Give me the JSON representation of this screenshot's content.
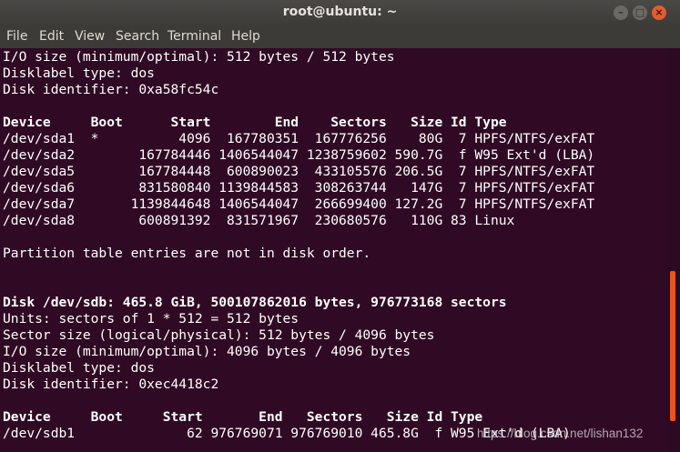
{
  "window": {
    "title": "root@ubuntu: ~",
    "min_symbol": "–",
    "max_symbol": "□",
    "close_symbol": "×"
  },
  "menu": [
    "File",
    "Edit",
    "View",
    "Search",
    "Terminal",
    "Help"
  ],
  "terminal_lines": [
    {
      "text": "I/O size (minimum/optimal): 512 bytes / 512 bytes",
      "bold": false
    },
    {
      "text": "Disklabel type: dos",
      "bold": false
    },
    {
      "text": "Disk identifier: 0xa58fc54c",
      "bold": false
    },
    {
      "text": "",
      "bold": false
    },
    {
      "text": "Device     Boot      Start        End    Sectors   Size Id Type",
      "bold": true
    },
    {
      "text": "/dev/sda1  *          4096  167780351  167776256    80G  7 HPFS/NTFS/exFAT",
      "bold": false
    },
    {
      "text": "/dev/sda2        167784446 1406544047 1238759602 590.7G  f W95 Ext'd (LBA)",
      "bold": false
    },
    {
      "text": "/dev/sda5        167784448  600890023  433105576 206.5G  7 HPFS/NTFS/exFAT",
      "bold": false
    },
    {
      "text": "/dev/sda6        831580840 1139844583  308263744   147G  7 HPFS/NTFS/exFAT",
      "bold": false
    },
    {
      "text": "/dev/sda7       1139844648 1406544047  266699400 127.2G  7 HPFS/NTFS/exFAT",
      "bold": false
    },
    {
      "text": "/dev/sda8        600891392  831571967  230680576   110G 83 Linux",
      "bold": false
    },
    {
      "text": "",
      "bold": false
    },
    {
      "text": "Partition table entries are not in disk order.",
      "bold": false
    },
    {
      "text": "",
      "bold": false
    },
    {
      "text": "",
      "bold": false
    },
    {
      "text": "Disk /dev/sdb: 465.8 GiB, 500107862016 bytes, 976773168 sectors",
      "bold": true
    },
    {
      "text": "Units: sectors of 1 * 512 = 512 bytes",
      "bold": false
    },
    {
      "text": "Sector size (logical/physical): 512 bytes / 4096 bytes",
      "bold": false
    },
    {
      "text": "I/O size (minimum/optimal): 4096 bytes / 4096 bytes",
      "bold": false
    },
    {
      "text": "Disklabel type: dos",
      "bold": false
    },
    {
      "text": "Disk identifier: 0xec4418c2",
      "bold": false
    },
    {
      "text": "",
      "bold": false
    },
    {
      "text": "Device     Boot     Start       End   Sectors   Size Id Type",
      "bold": true
    },
    {
      "text": "/dev/sdb1              62 976769071 976769010 465.8G  f W95 Ext'd (LBA)",
      "bold": false
    }
  ],
  "watermark": "https://blog.csdn.net/lishan132"
}
